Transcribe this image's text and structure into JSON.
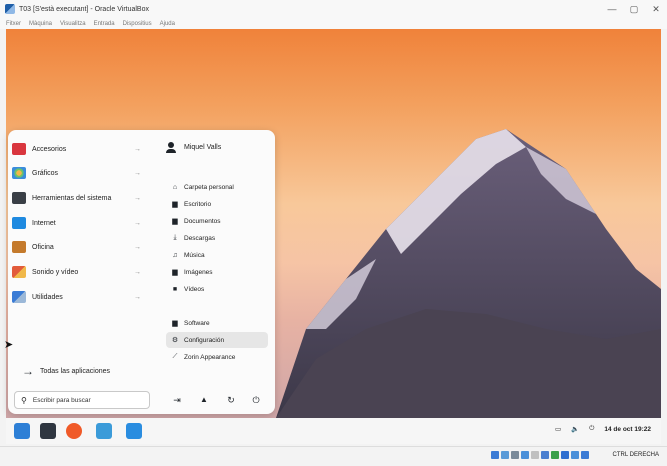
{
  "window": {
    "title": "T03 [S'està executant] - Oracle VirtualBox",
    "controls": [
      "—",
      "▢",
      "✕"
    ]
  },
  "vbox_menu": [
    "Fitxer",
    "Màquina",
    "Visualitza",
    "Entrada",
    "Dispositius",
    "Ajuda"
  ],
  "start_menu": {
    "categories": [
      {
        "label": "Accesorios",
        "icon": "toolbox-icon",
        "color": "#d9363e"
      },
      {
        "label": "Gráficos",
        "icon": "palette-icon",
        "color": "#f0b84a"
      },
      {
        "label": "Herramientas del sistema",
        "icon": "monitor-icon",
        "color": "#3a3f46"
      },
      {
        "label": "Internet",
        "icon": "cloud-icon",
        "color": "#1f8ae0"
      },
      {
        "label": "Oficina",
        "icon": "briefcase-icon",
        "color": "#c47a2c"
      },
      {
        "label": "Sonido y vídeo",
        "icon": "media-icon",
        "color": "#e25b3b"
      },
      {
        "label": "Utilidades",
        "icon": "utilities-icon",
        "color": "#3a7bd5"
      }
    ],
    "category_arrow": "→",
    "user_name": "Miquel Valls",
    "places": [
      {
        "label": "Carpeta personal",
        "icon": "home-icon",
        "glyph": "⌂"
      },
      {
        "label": "Escritorio",
        "icon": "desktop-icon",
        "glyph": "▆"
      },
      {
        "label": "Documentos",
        "icon": "document-icon",
        "glyph": "▆"
      },
      {
        "label": "Descargas",
        "icon": "download-icon",
        "glyph": "⤓"
      },
      {
        "label": "Música",
        "icon": "music-icon",
        "glyph": "♫"
      },
      {
        "label": "Imágenes",
        "icon": "image-icon",
        "glyph": "▆"
      },
      {
        "label": "Vídeos",
        "icon": "video-icon",
        "glyph": "■"
      }
    ],
    "system": [
      {
        "label": "Software",
        "icon": "software-icon",
        "glyph": "▆"
      },
      {
        "label": "Configuración",
        "icon": "gear-icon",
        "glyph": "⚙"
      },
      {
        "label": "Zorin Appearance",
        "icon": "appearance-icon",
        "glyph": "⟋"
      }
    ],
    "all_apps_label": "Todas las aplicaciones",
    "search_placeholder": "Escribir para buscar",
    "power_buttons": [
      {
        "icon": "logout-icon",
        "glyph": "⇥"
      },
      {
        "icon": "lock-icon",
        "glyph": "🔒"
      },
      {
        "icon": "restart-icon",
        "glyph": "↻"
      },
      {
        "icon": "power-icon",
        "glyph": "⏻"
      }
    ]
  },
  "taskbar": {
    "apps": [
      {
        "name": "zorin-menu-icon",
        "color": "#2d7fd6"
      },
      {
        "name": "terminal-icon",
        "color": "#2f3640"
      },
      {
        "name": "brave-browser-icon",
        "color": "#f05a28"
      },
      {
        "name": "files-icon",
        "color": "#3b9bd9"
      },
      {
        "name": "software-store-icon",
        "color": "#2a8de0"
      }
    ],
    "tray_glyphs": [
      "▭",
      "🔈",
      "⏻"
    ],
    "clock": "14 de oct 19:22"
  },
  "status_bar": {
    "icon_colors": [
      "#3a7bd5",
      "#5a9bd8",
      "#7a8a99",
      "#4a90d9",
      "#c0c0c0",
      "#4a7fd0",
      "#3aa04a",
      "#2f6fd0",
      "#4a90d9",
      "#3a7bd5"
    ],
    "host_key": "CTRL DERECHA"
  }
}
